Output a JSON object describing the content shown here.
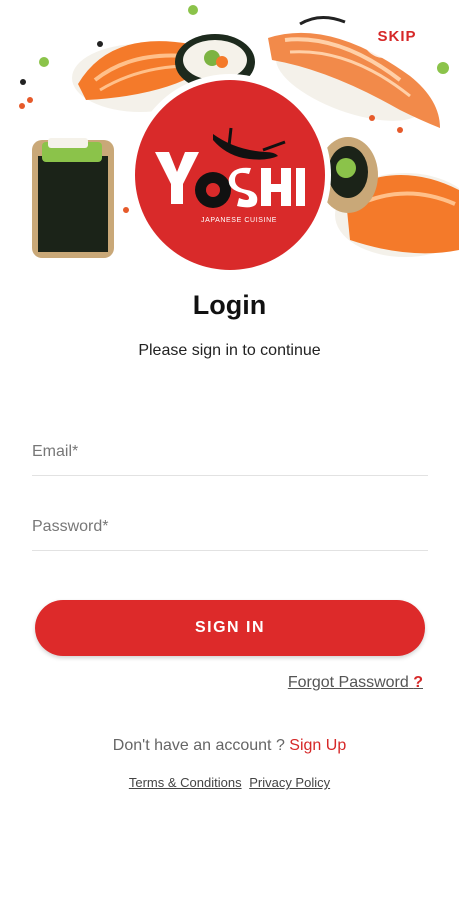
{
  "header": {
    "skip_label": "SKIP",
    "logo_text": "YOSHI",
    "logo_tagline": "JAPANESE CUISINE"
  },
  "login": {
    "title": "Login",
    "subtitle": "Please sign in to continue",
    "email_placeholder": "Email*",
    "email_value": "",
    "password_placeholder": "Password*",
    "password_value": "",
    "signin_label": "SIGN IN",
    "forgot_label": "Forgot Password",
    "forgot_suffix": "?"
  },
  "signup": {
    "prompt": "Don't have an account ?",
    "link": "Sign Up"
  },
  "legal": {
    "terms": "Terms & Conditions",
    "privacy": "Privacy Policy"
  },
  "colors": {
    "accent": "#dd2a2a",
    "text": "#111111",
    "muted": "#666666"
  }
}
